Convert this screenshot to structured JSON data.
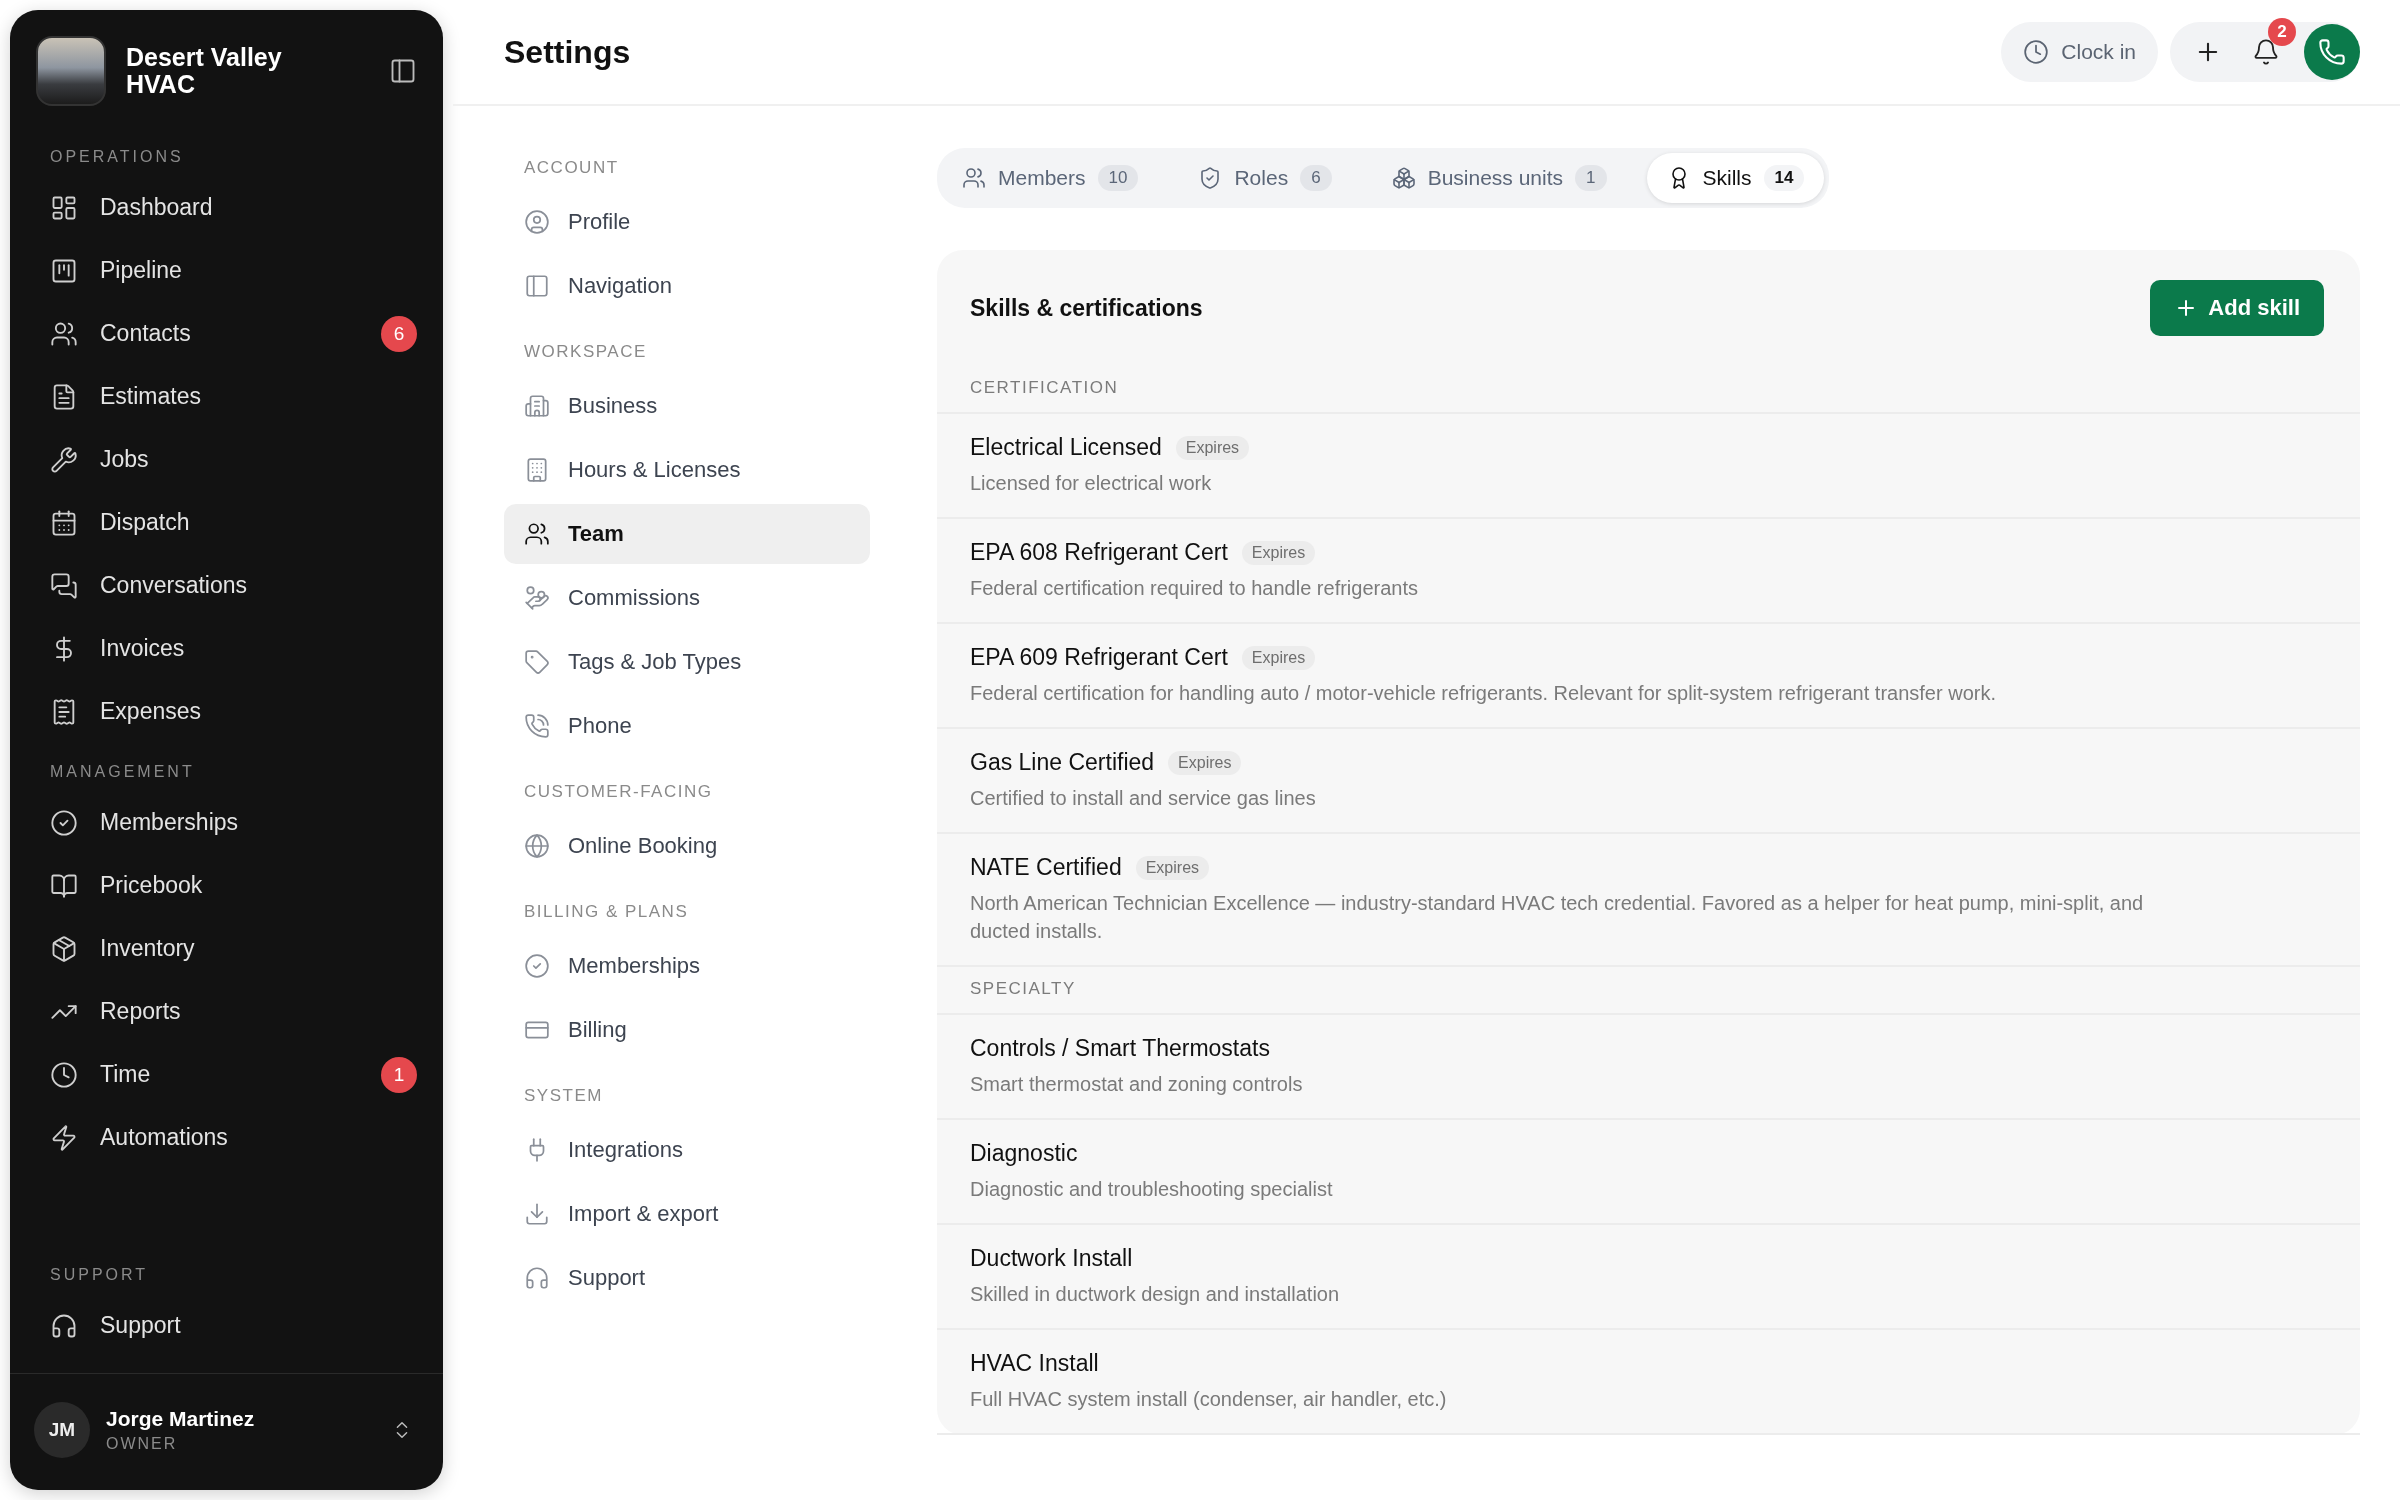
{
  "sidebar": {
    "brand": {
      "name": "Desert Valley HVAC"
    },
    "sections": [
      {
        "label": "OPERATIONS",
        "items": [
          {
            "label": "Dashboard"
          },
          {
            "label": "Pipeline"
          },
          {
            "label": "Contacts",
            "badge": "6"
          },
          {
            "label": "Estimates"
          },
          {
            "label": "Jobs"
          },
          {
            "label": "Dispatch"
          },
          {
            "label": "Conversations"
          },
          {
            "label": "Invoices"
          },
          {
            "label": "Expenses"
          }
        ]
      },
      {
        "label": "MANAGEMENT",
        "items": [
          {
            "label": "Memberships"
          },
          {
            "label": "Pricebook"
          },
          {
            "label": "Inventory"
          },
          {
            "label": "Reports"
          },
          {
            "label": "Time",
            "badge": "1"
          },
          {
            "label": "Automations"
          }
        ]
      },
      {
        "label": "SUPPORT",
        "items": [
          {
            "label": "Support"
          }
        ]
      }
    ],
    "user": {
      "initials": "JM",
      "name": "Jorge Martinez",
      "role": "OWNER"
    }
  },
  "header": {
    "title": "Settings",
    "clock_in": "Clock in",
    "notifications": "2"
  },
  "settings_nav": [
    {
      "label": "ACCOUNT",
      "items": [
        {
          "label": "Profile",
          "selected": false
        },
        {
          "label": "Navigation",
          "selected": false
        }
      ]
    },
    {
      "label": "WORKSPACE",
      "items": [
        {
          "label": "Business",
          "selected": false
        },
        {
          "label": "Hours & Licenses",
          "selected": false
        },
        {
          "label": "Team",
          "selected": true
        },
        {
          "label": "Commissions",
          "selected": false
        },
        {
          "label": "Tags & Job Types",
          "selected": false
        },
        {
          "label": "Phone",
          "selected": false
        }
      ]
    },
    {
      "label": "CUSTOMER-FACING",
      "items": [
        {
          "label": "Online Booking",
          "selected": false
        }
      ]
    },
    {
      "label": "BILLING & PLANS",
      "items": [
        {
          "label": "Memberships",
          "selected": false
        },
        {
          "label": "Billing",
          "selected": false
        }
      ]
    },
    {
      "label": "SYSTEM",
      "items": [
        {
          "label": "Integrations",
          "selected": false
        },
        {
          "label": "Import & export",
          "selected": false
        },
        {
          "label": "Support",
          "selected": false
        }
      ]
    }
  ],
  "tabs": [
    {
      "label": "Members",
      "count": "10",
      "selected": false
    },
    {
      "label": "Roles",
      "count": "6",
      "selected": false
    },
    {
      "label": "Business units",
      "count": "1",
      "selected": false
    },
    {
      "label": "Skills",
      "count": "14",
      "selected": true
    }
  ],
  "skills": {
    "title": "Skills & certifications",
    "add_button": "Add skill",
    "groups": [
      {
        "label": "CERTIFICATION",
        "items": [
          {
            "name": "Electrical Licensed",
            "badge": "Expires",
            "description": "Licensed for electrical work"
          },
          {
            "name": "EPA 608 Refrigerant Cert",
            "badge": "Expires",
            "description": "Federal certification required to handle refrigerants"
          },
          {
            "name": "EPA 609 Refrigerant Cert",
            "badge": "Expires",
            "description": "Federal certification for handling auto / motor-vehicle refrigerants. Relevant for split-system refrigerant transfer work."
          },
          {
            "name": "Gas Line Certified",
            "badge": "Expires",
            "description": "Certified to install and service gas lines"
          },
          {
            "name": "NATE Certified",
            "badge": "Expires",
            "description": "North American Technician Excellence — industry-standard HVAC tech credential. Favored as a helper for heat pump, mini-split, and ducted installs."
          }
        ]
      },
      {
        "label": "SPECIALTY",
        "items": [
          {
            "name": "Controls / Smart Thermostats",
            "description": "Smart thermostat and zoning controls"
          },
          {
            "name": "Diagnostic",
            "description": "Diagnostic and troubleshooting specialist"
          },
          {
            "name": "Ductwork Install",
            "description": "Skilled in ductwork design and installation"
          },
          {
            "name": "HVAC Install",
            "description": "Full HVAC system install (condenser, air handler, etc.)"
          }
        ]
      }
    ]
  }
}
